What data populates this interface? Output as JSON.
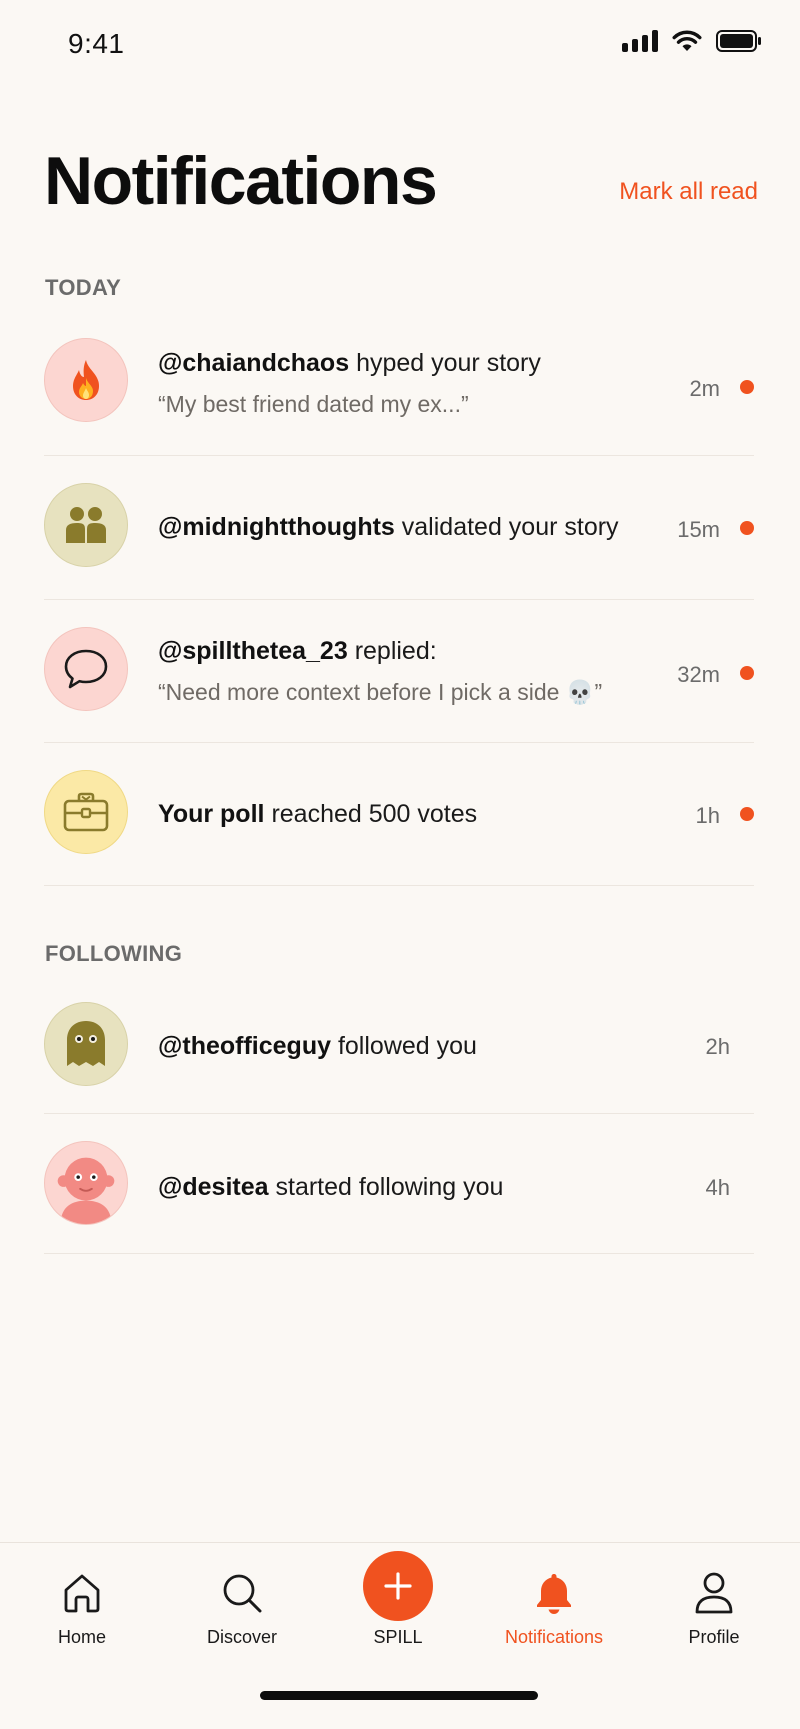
{
  "status_bar": {
    "time": "9:41"
  },
  "header": {
    "title": "Notifications",
    "mark_all_label": "Mark all read"
  },
  "sections": {
    "today": "TODAY",
    "following": "FOLLOWING"
  },
  "today_items": [
    {
      "user": "@chaiandchaos",
      "action": "hyped your story",
      "sub": "“My best friend dated my ex...”",
      "time": "2m",
      "unread": true,
      "icon": "fire-icon"
    },
    {
      "user": "@midnightthoughts",
      "action": "validated your story",
      "time": "15m",
      "unread": true,
      "icon": "people-icon"
    },
    {
      "user": "@spillthetea_23",
      "action": "replied:",
      "sub": "“Need more context before I pick a side 💀”",
      "time": "32m",
      "unread": true,
      "icon": "speech-bubble-icon"
    },
    {
      "user": "Your poll",
      "action": "reached 500 votes",
      "time": "1h",
      "unread": true,
      "icon": "briefcase-icon"
    }
  ],
  "following_items": [
    {
      "user": "@theofficeguy",
      "action": "followed you",
      "time": "2h",
      "icon": "ghost-avatar-icon"
    },
    {
      "user": "@desitea",
      "action": "started following you",
      "time": "4h",
      "icon": "face-avatar-icon"
    }
  ],
  "nav": {
    "home": "Home",
    "discover": "Discover",
    "spill": "SPILL",
    "notifications": "Notifications",
    "profile": "Profile"
  },
  "colors": {
    "accent": "#f0521f",
    "background": "#fbf8f4"
  }
}
